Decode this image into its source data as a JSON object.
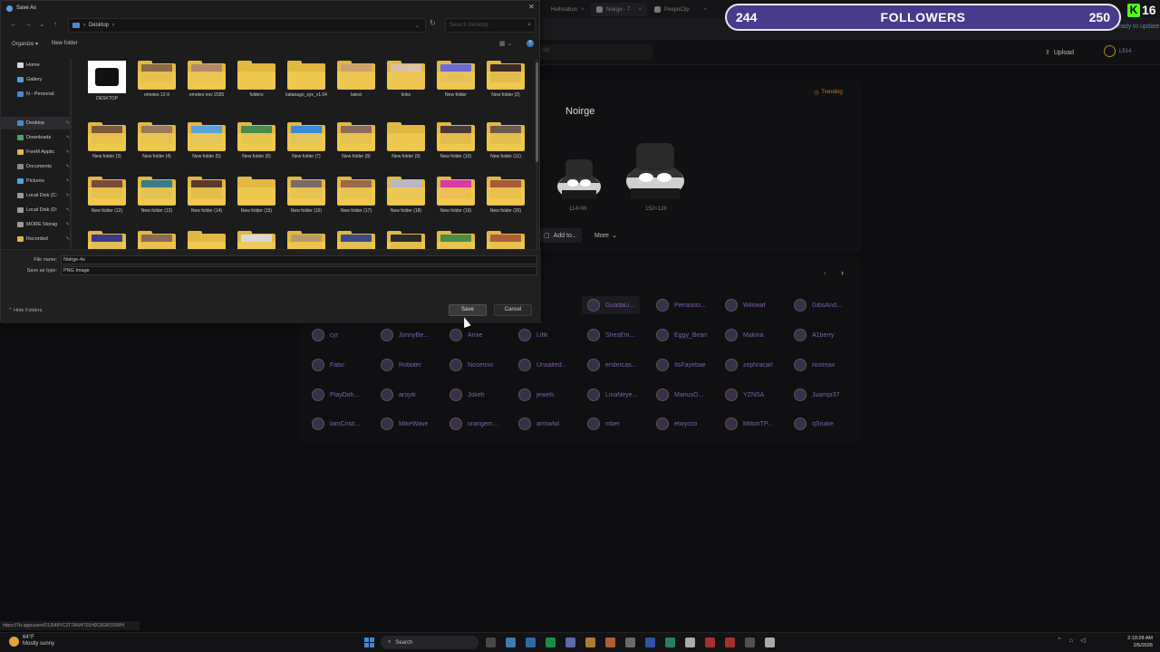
{
  "browser": {
    "tabs": [
      "Hellorabun",
      "Noirge - 7",
      "PeepoClip",
      ""
    ],
    "update_label": "Ready to update",
    "site_search_placeholder": "rch",
    "upload_label": "Upload",
    "user_label": "L514"
  },
  "emote": {
    "trending_label": "Trending",
    "name": "Noirge",
    "size_small": "114×96",
    "size_large": "152×128",
    "add_to_label": "Add to...",
    "more_label": "More"
  },
  "users": [
    {
      "name": "etrora"
    },
    {
      "name": "GuadaLi..."
    },
    {
      "name": "Pierasoci..."
    },
    {
      "name": "Wilowaf"
    },
    {
      "name": "GibsAnd..."
    },
    {
      "name": "cyr"
    },
    {
      "name": "JonnyBe..."
    },
    {
      "name": "Arnie"
    },
    {
      "name": "Lifik"
    },
    {
      "name": "ShesEm..."
    },
    {
      "name": "Eggy_Bean"
    },
    {
      "name": "Makina"
    },
    {
      "name": "A1berry"
    },
    {
      "name": "Fabo"
    },
    {
      "name": "Roboter"
    },
    {
      "name": "Noserino"
    },
    {
      "name": "Unsalted..."
    },
    {
      "name": "endercas..."
    },
    {
      "name": "ItsFayebae"
    },
    {
      "name": "zephracarl"
    },
    {
      "name": "nooreax"
    },
    {
      "name": "PlayDoh..."
    },
    {
      "name": "aroyiti"
    },
    {
      "name": "Jokeh"
    },
    {
      "name": "jewels"
    },
    {
      "name": "LinaNeye..."
    },
    {
      "name": "MariusO..."
    },
    {
      "name": "YZNSA"
    },
    {
      "name": "Juampi37"
    },
    {
      "name": "IamCristi..."
    },
    {
      "name": "MikeWave"
    },
    {
      "name": "orangem..."
    },
    {
      "name": "arrowtol"
    },
    {
      "name": "mber"
    },
    {
      "name": "etwycco"
    },
    {
      "name": "MiltonTP..."
    },
    {
      "name": "qSnake"
    }
  ],
  "followers": {
    "current": "244",
    "label": "FOLLOWERS",
    "goal": "250",
    "kick_count": "16"
  },
  "dialog": {
    "title": "Save As",
    "path": "Desktop",
    "path_sep": "›",
    "search_placeholder": "Search Desktop",
    "organize_label": "Organize ▾",
    "new_folder_label": "New folder",
    "nav": [
      {
        "label": "Home",
        "color": "#d9d9d9"
      },
      {
        "label": "Gallery",
        "color": "#4aa3df"
      },
      {
        "label": "N - Personal",
        "color": "#4a8ad0"
      },
      {
        "label": "Desktop",
        "color": "#4a8ad0"
      },
      {
        "label": "Downloads",
        "color": "#4aa36a"
      },
      {
        "label": "FiveM Applic",
        "color": "#e3b842"
      },
      {
        "label": "Documents",
        "color": "#8a8a8a"
      },
      {
        "label": "Pictures",
        "color": "#4aa3df"
      },
      {
        "label": "Local Disk (C:",
        "color": "#9a9a9a"
      },
      {
        "label": "Local Disk (D:",
        "color": "#9a9a9a"
      },
      {
        "label": "MORE Storag",
        "color": "#9a9a9a"
      },
      {
        "label": "Recorded",
        "color": "#e3b842"
      },
      {
        "label": "",
        "color": "#9a9a9a"
      }
    ],
    "items": [
      {
        "label": "DESKTOP",
        "kind": "image"
      },
      {
        "label": "emotes 12-9",
        "kind": "folder",
        "pic": "#8a6a4a"
      },
      {
        "label": "emotes nov 2025",
        "kind": "folder",
        "pic": "#b08a6a"
      },
      {
        "label": "folders",
        "kind": "folder",
        "pic": ""
      },
      {
        "label": "katanago_sys_v1.04",
        "kind": "folder",
        "pic": ""
      },
      {
        "label": "latest",
        "kind": "folder",
        "pic": "#caa070"
      },
      {
        "label": "links",
        "kind": "folder",
        "pic": "#d8c2a8"
      },
      {
        "label": "New folder",
        "kind": "folder",
        "pic": "#6a6ad8"
      },
      {
        "label": "New folder (2)",
        "kind": "folder",
        "pic": "#3a2a2a"
      },
      {
        "label": "New folder (3)",
        "kind": "folder",
        "pic": "#7a5a3a"
      },
      {
        "label": "New folder (4)",
        "kind": "folder",
        "pic": "#9a7a5a"
      },
      {
        "label": "New folder (5)",
        "kind": "folder",
        "pic": "#5aa0d8"
      },
      {
        "label": "New folder (6)",
        "kind": "folder",
        "pic": "#4a8a4a"
      },
      {
        "label": "New folder (7)",
        "kind": "folder",
        "pic": "#3a8ad8"
      },
      {
        "label": "New folder (8)",
        "kind": "folder",
        "pic": "#8a6a5a"
      },
      {
        "label": "New folder (9)",
        "kind": "folder",
        "pic": ""
      },
      {
        "label": "New folder (10)",
        "kind": "folder",
        "pic": "#4a3a3a"
      },
      {
        "label": "New folder (11)",
        "kind": "folder",
        "pic": "#6a5a4a"
      },
      {
        "label": "New folder (12)",
        "kind": "folder",
        "pic": "#7a4a3a"
      },
      {
        "label": "New folder (13)",
        "kind": "folder",
        "pic": "#3a7a8a"
      },
      {
        "label": "New folder (14)",
        "kind": "folder",
        "pic": "#5a3a2a"
      },
      {
        "label": "New folder (15)",
        "kind": "folder",
        "pic": ""
      },
      {
        "label": "New folder (16)",
        "kind": "folder",
        "pic": "#7a6a6a"
      },
      {
        "label": "New folder (17)",
        "kind": "folder",
        "pic": "#9a6a4a"
      },
      {
        "label": "New folder (18)",
        "kind": "folder",
        "pic": "#b8b8c8"
      },
      {
        "label": "New folder (19)",
        "kind": "folder",
        "pic": "#d83aa8"
      },
      {
        "label": "New folder (20)",
        "kind": "folder",
        "pic": "#a85a3a"
      },
      {
        "label": "",
        "kind": "folder",
        "pic": "#3a3a8a"
      },
      {
        "label": "",
        "kind": "folder",
        "pic": "#8a6a5a"
      },
      {
        "label": "",
        "kind": "folder",
        "pic": ""
      },
      {
        "label": "",
        "kind": "folder",
        "pic": "#d8d8d8"
      },
      {
        "label": "",
        "kind": "folder",
        "pic": "#b89a6a"
      },
      {
        "label": "",
        "kind": "folder",
        "pic": "#3a4a8a"
      },
      {
        "label": "",
        "kind": "folder",
        "pic": "#2a2a2a"
      },
      {
        "label": "",
        "kind": "folder",
        "pic": "#4a8a4a"
      },
      {
        "label": "",
        "kind": "folder",
        "pic": "#a8603a"
      }
    ],
    "file_name_label": "File name:",
    "file_name_value": "Noirge-4x",
    "save_type_label": "Save as type:",
    "save_type_value": "PNG Image",
    "hide_folders_label": "Hide Folders",
    "save_label": "Save",
    "cancel_label": "Cancel"
  },
  "status_url": "https://7tv.app/users/01J549YC2T7AW4T01H9C8GB15SMH",
  "taskbar": {
    "temp": "64°F",
    "weather": "Mostly sunny",
    "search_label": "Search",
    "time": "2:10:28 AM",
    "date": "2/5/2026"
  },
  "colors": {
    "follower_bar": "#4a3a8c",
    "kick_green": "#53fc18",
    "user_name": "#7e5fb0",
    "folder": "#e3b842"
  }
}
